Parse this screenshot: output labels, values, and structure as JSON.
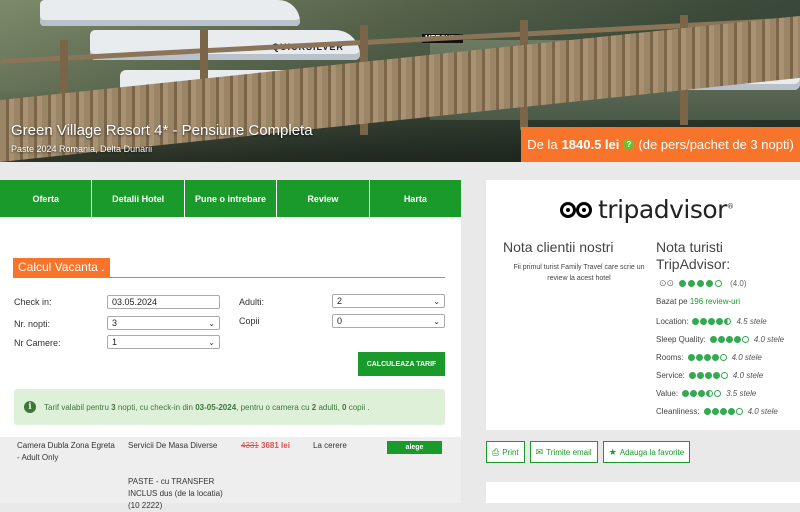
{
  "hero": {
    "title": "Green Village Resort 4* - Pensiune Completa",
    "subtitle": "Paste 2024 Romania, Delta Dunarii",
    "boat_label": "QUICKSILVER",
    "motor_label": "MERCURY",
    "price": {
      "prefix": "De la",
      "amount": "1840.5 lei",
      "help": "?",
      "suffix": "(de pers/pachet de 3 nopti)"
    }
  },
  "tabs": [
    "Oferta",
    "Detalii Hotel",
    "Pune o intrebare",
    "Review",
    "Harta"
  ],
  "calc": {
    "heading": "Calcul Vacanta",
    "checkin_label": "Check in:",
    "checkin_value": "03.05.2024",
    "nopti_label": "Nr. nopti:",
    "nopti_value": "3",
    "camere_label": "Nr Camere:",
    "camere_value": "1",
    "adulti_label": "Adulti:",
    "adulti_value": "2",
    "copii_label": "Copii",
    "copii_value": "0",
    "button": "CALCULEAZA TARIF"
  },
  "info": {
    "icon": "i",
    "text_a": "Tarif valabil pentru",
    "nopti": "3",
    "text_b": "nopti, cu check-in din",
    "date": "03-05-2024",
    "text_c": ", pentru o camera cu",
    "adulti": "2",
    "text_d": "adulti,",
    "copii": "0",
    "text_e": "copii ."
  },
  "room": {
    "name": "Camera Dubla Zona Egreta - Adult Only",
    "service1": "Servicii De Masa Diverse",
    "service2": "PASTE - cu TRANSFER INCLUS dus (de la",
    "service3": "locatia) (10 2222)",
    "old_price": "4331",
    "new_price": "3681 lei",
    "availability": "La cerere",
    "choose": "alege"
  },
  "tripadvisor": {
    "brand": "tripadvisor",
    "reg": "®",
    "our_title": "Nota clientii nostri",
    "our_text": "Fii primul turist Family Travel care scrie un review la acest hotel",
    "ta_title": "Nota turisti TripAdvisor:",
    "rating_text": "(4.0)",
    "rating_value": 4.0,
    "based_prefix": "Bazat pe",
    "based_link": "196 review-uri",
    "subratings": [
      {
        "label": "Location:",
        "value": "4.5 stele",
        "score": 4.5
      },
      {
        "label": "Sleep Quality:",
        "value": "4.0 stele",
        "score": 4.0
      },
      {
        "label": "Rooms:",
        "value": "4.0 stele",
        "score": 4.0
      },
      {
        "label": "Service:",
        "value": "4.0 stele",
        "score": 4.0
      },
      {
        "label": "Value:",
        "value": "3.5 stele",
        "score": 3.5
      },
      {
        "label": "Cleanliness:",
        "value": "4.0 stele",
        "score": 4.0
      }
    ]
  },
  "actions": {
    "print": "Print",
    "email": "Trimite email",
    "favorite": "Adauga la favorite"
  },
  "colors": {
    "green": "#1a9a2b",
    "orange": "#f7742a",
    "ta_green": "#34a853"
  }
}
